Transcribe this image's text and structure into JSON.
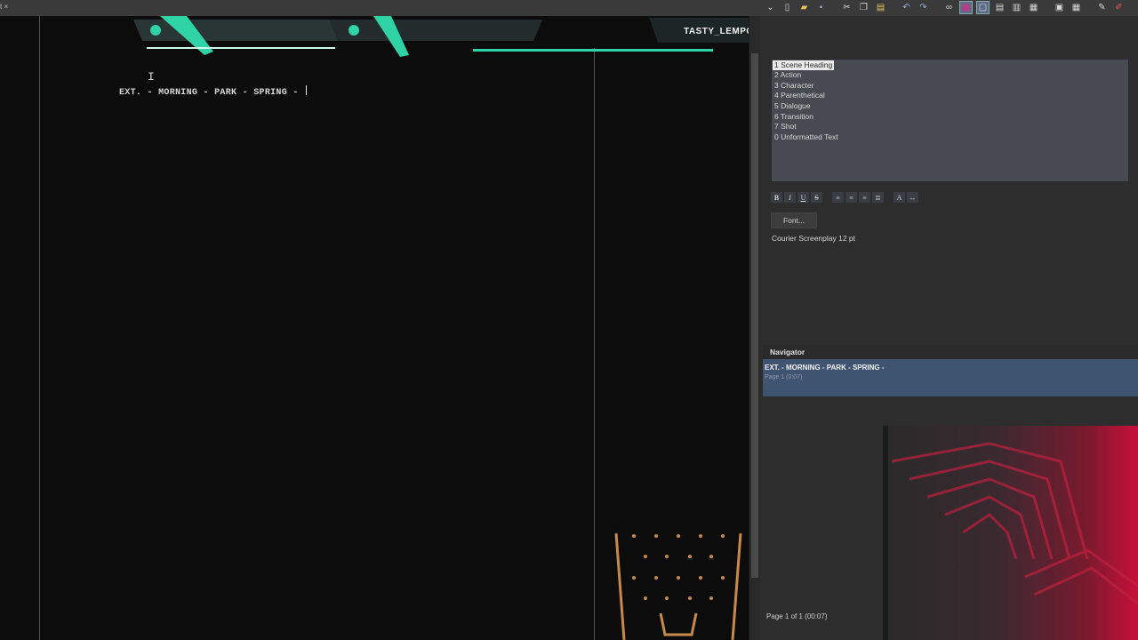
{
  "window": {
    "tab_fragment": "t ×"
  },
  "toolbar": {
    "icons": [
      "dropdown-icon",
      "new-document-icon",
      "open-folder-icon",
      "save-icon",
      "cut-icon",
      "copy-icon",
      "paste-icon",
      "undo-icon",
      "redo-icon",
      "binoculars-icon",
      "paint-icon",
      "layout-page-icon",
      "layout-normal-icon",
      "layout-split-icon",
      "layout-columns-icon",
      "layout-a-icon",
      "layout-b-icon",
      "wrench-icon",
      "edit-icon"
    ]
  },
  "overlay": {
    "username": "TASTY_LEMPONS"
  },
  "editor": {
    "scene_heading": "EXT. - MORNING - PARK - SPRING - "
  },
  "styles": {
    "items": [
      "1 Scene Heading",
      "2 Action",
      "3 Character",
      "4 Parenthetical",
      "5 Dialogue",
      "6 Transition",
      "7 Shot",
      "0 Unformatted Text"
    ],
    "selected_index": 0
  },
  "format": {
    "buttons": [
      "B",
      "I",
      "U",
      "S"
    ],
    "align_icons": [
      "align-left-icon",
      "align-center-icon",
      "align-right-icon",
      "align-justify-icon"
    ],
    "extra_icons": [
      "font-size-icon",
      "spacing-icon"
    ],
    "font_button": "Font...",
    "font_desc": "Courier Screenplay 12 pt"
  },
  "navigator": {
    "title": "Navigator",
    "item_heading": "EXT. - MORNING - PARK - SPRING -",
    "item_sub": "Page 1 (0:07)",
    "page_info": "Page 1 of 1 (00:07)"
  },
  "colors": {
    "accent": "#2fd3a6",
    "nav_selected": "#3f5471",
    "style_box": "#484a52"
  }
}
